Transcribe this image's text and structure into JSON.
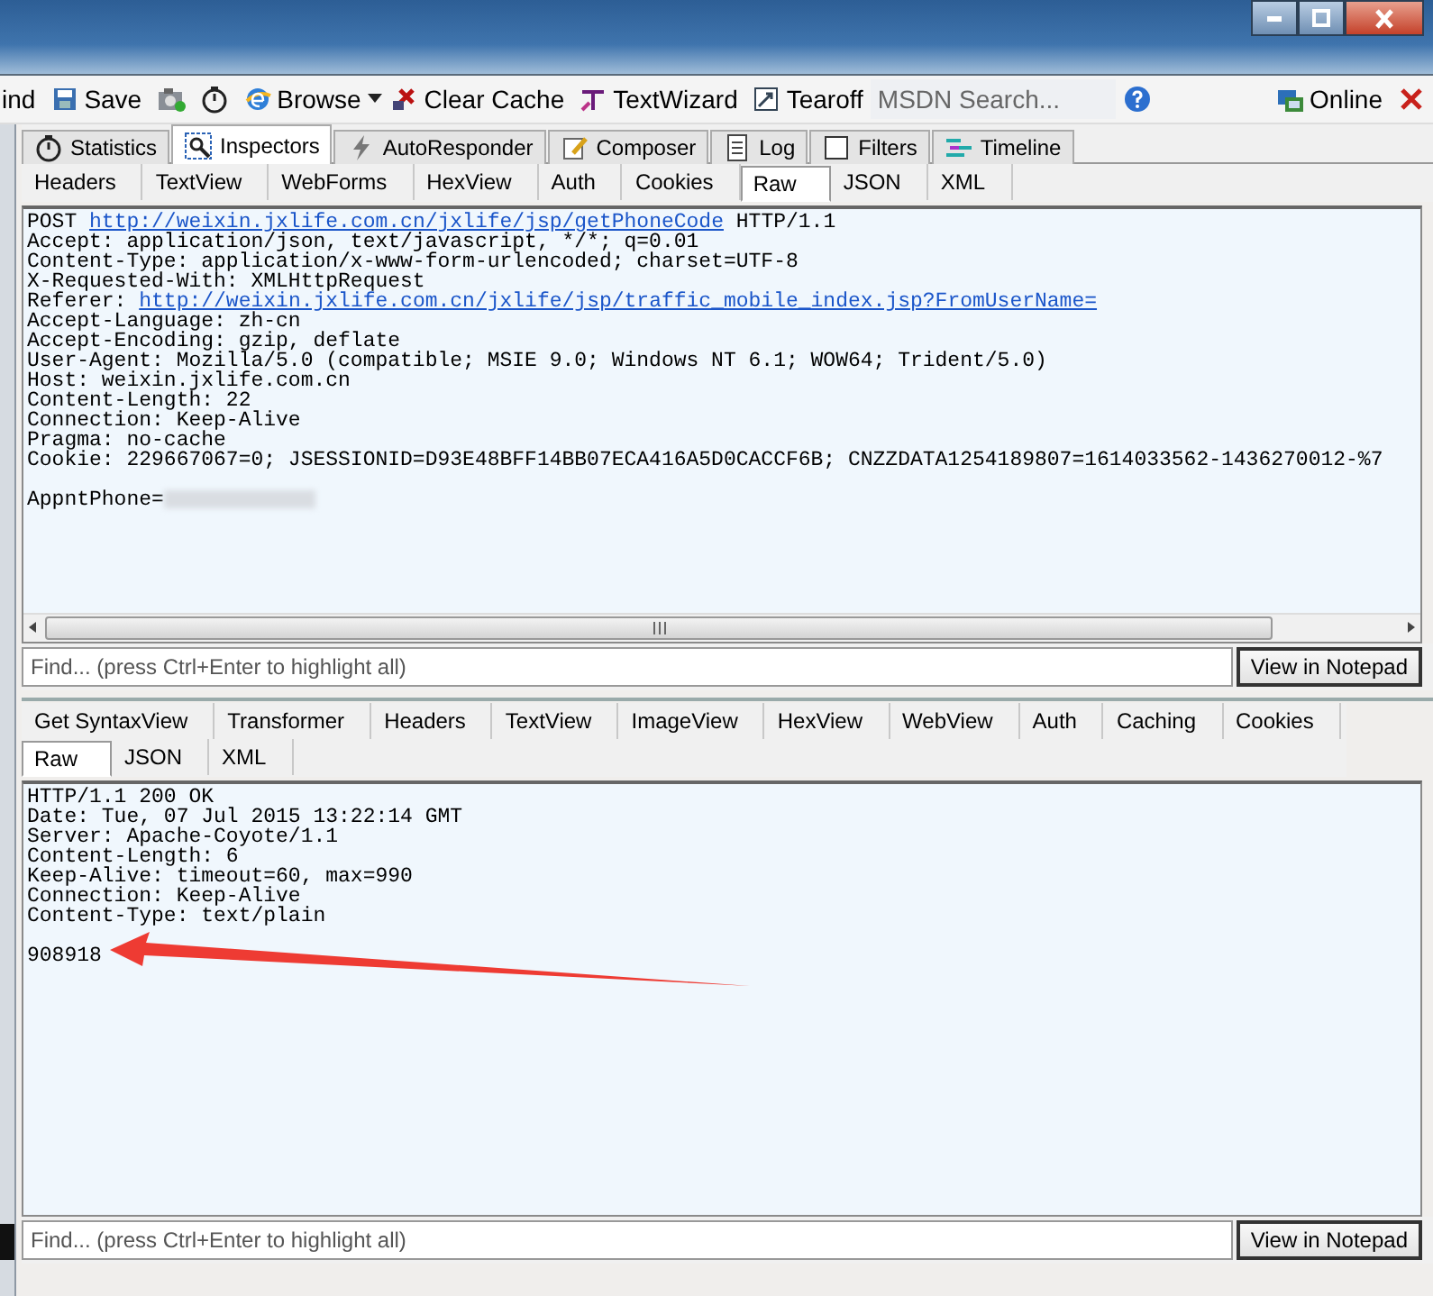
{
  "toolbar": {
    "items": [
      {
        "kind": "text",
        "label": "ind"
      },
      {
        "kind": "button",
        "label": "Save"
      },
      {
        "kind": "icon"
      },
      {
        "kind": "icon"
      },
      {
        "kind": "button",
        "label": "Browse"
      },
      {
        "kind": "caret"
      },
      {
        "kind": "button",
        "label": "Clear Cache"
      },
      {
        "kind": "button",
        "label": "TextWizard"
      },
      {
        "kind": "button",
        "label": "Tearoff"
      },
      {
        "kind": "search",
        "placeholder": "MSDN Search..."
      },
      {
        "kind": "icon"
      }
    ],
    "right": [
      {
        "kind": "button",
        "label": "Online"
      },
      {
        "kind": "icon"
      }
    ]
  },
  "main_tabs": [
    {
      "label": "Statistics",
      "selected": false
    },
    {
      "label": "Inspectors",
      "selected": true
    },
    {
      "label": "AutoResponder",
      "selected": false
    },
    {
      "label": "Composer",
      "selected": false
    },
    {
      "label": "Log",
      "selected": false
    },
    {
      "label": "Filters",
      "selected": false
    },
    {
      "label": "Timeline",
      "selected": false
    }
  ],
  "request": {
    "tabs": [
      {
        "label": "Headers",
        "selected": false
      },
      {
        "label": "TextView",
        "selected": false
      },
      {
        "label": "WebForms",
        "selected": false
      },
      {
        "label": "HexView",
        "selected": false
      },
      {
        "label": "Auth",
        "selected": false
      },
      {
        "label": "Cookies",
        "selected": false
      },
      {
        "label": "Raw",
        "selected": true
      },
      {
        "label": "JSON",
        "selected": false
      },
      {
        "label": "XML",
        "selected": false
      }
    ],
    "lines": [
      {
        "prefix": "POST ",
        "link": "http://weixin.jxlife.com.cn/jxlife/jsp/getPhoneCode",
        "suffix": " HTTP/1.1"
      },
      {
        "prefix": "Accept: application/json, text/javascript, */*; q=0.01"
      },
      {
        "prefix": "Content-Type: application/x-www-form-urlencoded; charset=UTF-8"
      },
      {
        "prefix": "X-Requested-With: XMLHttpRequest"
      },
      {
        "prefix": "Referer: ",
        "link": "http://weixin.jxlife.com.cn/jxlife/jsp/traffic_mobile_index.jsp?FromUserName="
      },
      {
        "prefix": "Accept-Language: zh-cn"
      },
      {
        "prefix": "Accept-Encoding: gzip, deflate"
      },
      {
        "prefix": "User-Agent: Mozilla/5.0 (compatible; MSIE 9.0; Windows NT 6.1; WOW64; Trident/5.0)"
      },
      {
        "prefix": "Host: weixin.jxlife.com.cn"
      },
      {
        "prefix": "Content-Length: 22"
      },
      {
        "prefix": "Connection: Keep-Alive"
      },
      {
        "prefix": "Pragma: no-cache"
      },
      {
        "prefix": "Cookie: 229667067=0; JSESSIONID=D93E48BFF14BB07ECA416A5D0CACCF6B; CNZZDATA1254189807=1614033562-1436270012-%7"
      },
      {
        "prefix": "AppntPhone=",
        "gap_before": true,
        "redacted": true
      }
    ],
    "find": {
      "placeholder": "Find... (press Ctrl+Enter to highlight all)",
      "button": "View in Notepad"
    }
  },
  "response": {
    "tabs": [
      {
        "label": "Get SyntaxView",
        "selected": false
      },
      {
        "label": "Transformer",
        "selected": false
      },
      {
        "label": "Headers",
        "selected": false
      },
      {
        "label": "TextView",
        "selected": false
      },
      {
        "label": "ImageView",
        "selected": false
      },
      {
        "label": "HexView",
        "selected": false
      },
      {
        "label": "WebView",
        "selected": false
      },
      {
        "label": "Auth",
        "selected": false
      },
      {
        "label": "Caching",
        "selected": false
      },
      {
        "label": "Cookies",
        "selected": false
      },
      {
        "label": "Raw",
        "selected": true
      },
      {
        "label": "JSON",
        "selected": false
      },
      {
        "label": "XML",
        "selected": false
      }
    ],
    "lines": [
      {
        "prefix": "HTTP/1.1 200 OK"
      },
      {
        "prefix": "Date: Tue, 07 Jul 2015 13:22:14 GMT"
      },
      {
        "prefix": "Server: Apache-Coyote/1.1"
      },
      {
        "prefix": "Content-Length: 6"
      },
      {
        "prefix": "Keep-Alive: timeout=60, max=990"
      },
      {
        "prefix": "Connection: Keep-Alive"
      },
      {
        "prefix": "Content-Type: text/plain"
      },
      {
        "prefix": "908918",
        "gap_before": true,
        "arrow": true
      }
    ],
    "find": {
      "placeholder": "Find... (press Ctrl+Enter to highlight all)",
      "button": "View in Notepad"
    }
  }
}
